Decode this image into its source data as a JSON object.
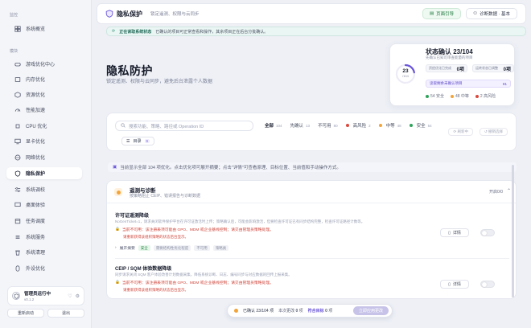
{
  "sidebar": {
    "section_monitor": "监控",
    "section_modules": "模块",
    "items": [
      {
        "label": "系统概览",
        "icon": "grid-icon"
      },
      {
        "label": "游戏优化中心",
        "icon": "gamepad-icon"
      },
      {
        "label": "内存优化",
        "icon": "memory-icon"
      },
      {
        "label": "资源优化",
        "icon": "cube-icon"
      },
      {
        "label": "性能加速",
        "icon": "speed-icon"
      },
      {
        "label": "CPU 优化",
        "icon": "cpu-icon"
      },
      {
        "label": "显卡优化",
        "icon": "display-icon"
      },
      {
        "label": "网络优化",
        "icon": "globe-icon"
      },
      {
        "label": "隐私保护",
        "icon": "shield-icon",
        "active": true
      },
      {
        "label": "系统调校",
        "icon": "sliders-icon"
      },
      {
        "label": "桌面体验",
        "icon": "desktop-icon"
      },
      {
        "label": "任务调度",
        "icon": "calendar-icon"
      },
      {
        "label": "系统服务",
        "icon": "list-icon"
      },
      {
        "label": "系统清理",
        "icon": "trash-icon"
      },
      {
        "label": "外设优化",
        "icon": "mouse-icon"
      }
    ],
    "admin": {
      "title": "管理员运行中",
      "version": "v0.1.2"
    },
    "restart_label": "重新启动",
    "exit_label": "退出"
  },
  "topbar": {
    "title": "隐私保护",
    "subtitle": "锁定遥测、权限与云同步",
    "guide_label": "页面引导",
    "diag_label": "诊断数据 · 基本"
  },
  "notice": {
    "bold": "正在读取系统状态",
    "text": "已确认的项目可正常查看和操作，其余项目正在后台分批确认。"
  },
  "hero": {
    "title": "隐私防护",
    "subtitle": "锁定遥测、权限与云同步，避免后台泄露个人数据"
  },
  "status": {
    "title": "状态确认 23/104",
    "subtitle": "先确认已知可审查能量的项目",
    "ring_value": "23",
    "ring_total": "/104",
    "progress_fraction": 0.221,
    "done_label": "资经优化已完成",
    "done_value": "0项",
    "pending_label": "运转状态已调整",
    "pending_value": "0项",
    "reading_label": "读取剩余未确认项目",
    "reading_value": "81",
    "legend": [
      {
        "label": "54 安全",
        "color": "#2fa35a"
      },
      {
        "label": "48 中等",
        "color": "#f2a33a"
      },
      {
        "label": "2 高风险",
        "color": "#d94a3f"
      }
    ]
  },
  "filter": {
    "search_placeholder": "搜索功能、策略、路径或 Operation ID",
    "chips": [
      {
        "label": "全部",
        "count": "104",
        "active": true
      },
      {
        "label": "先确认",
        "count": "13"
      },
      {
        "label": "不可用",
        "count": "80"
      },
      {
        "label": "高风险",
        "count": "2",
        "dot": "#d94a3f"
      },
      {
        "label": "中等",
        "count": "48",
        "dot": "#f2a33a"
      },
      {
        "label": "安全",
        "count": "54",
        "dot": "#2fa35a"
      }
    ],
    "refresh_label": "刷新中",
    "undo_label": "撤销选择",
    "dir_label": "目录",
    "dir_count": "9"
  },
  "info_line": "当前显示全部 104 项优化。点击优化项可展开摘要；点击\"详情\"可查看原理、目标位置、当前值和手动操作方式。",
  "group": {
    "title": "遥测与诊断",
    "subtitle": "按策略阻止 CEIP、错误报告与诊断数据",
    "count": "开启0/0",
    "items": [
      {
        "title": "许可证遥测降级",
        "desc": "NoGenTicket=1，请求关闭软件保护平台在许可证激活时上传；策略确认后，可能会影响激活，但要检查许可证已有同步结构完整，检查许可证路径计数等。",
        "warn": "当前不可用：该注册表项可能由 GPO、MDM 或企业基线控制；请交由管理员策略处理。",
        "warn2": "请重新获得该组织策略的状态后台显示。",
        "detail_label": "详情",
        "expand_label": "展开摘要",
        "tags": [
          "安全",
          "需要结构性优化程度",
          "不可用",
          "策略类"
        ]
      },
      {
        "title": "CEIP / SQM 体验数据降级",
        "desc": "同步请求关闭 SQM 客户体验改善计划数据采集，降低系统诊断、日志、编号同步与对应数据的回传上报采集。",
        "warn": "当前不可用：该注册表项可能由 GPO、MDM 或企业基线控制；请交由管理员策略处理。",
        "warn2": "请重新获得该组织策略的状态后台显示。",
        "detail_label": "详情"
      }
    ]
  },
  "bottom_bar": {
    "confirmed": "已确认 23/104 项",
    "changes": "本次更改",
    "changes_value": "0",
    "changes_unit": "项",
    "link_label": "符合目标",
    "link_value": "0",
    "link_unit": "项",
    "apply_label": "立即应用更改"
  }
}
